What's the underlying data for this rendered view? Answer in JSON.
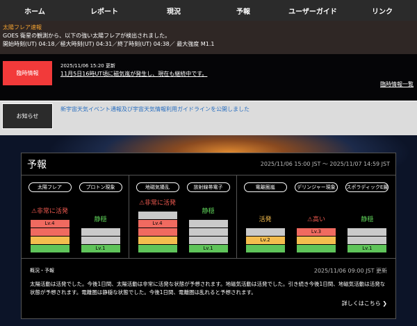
{
  "nav": [
    "ホーム",
    "レポート",
    "現況",
    "予報",
    "ユーザーガイド",
    "リンク"
  ],
  "alert": {
    "title": "太陽フレア速報",
    "line1": "GOES 衛星の観測から、以下の強い太陽フレアが検出されました。",
    "line2": "開始時刻(UT) 04:18／極大時刻(UT) 04:31／終了時刻(UT) 04:38／ 最大強度 M1.1"
  },
  "rapid": {
    "badge": "臨時情報",
    "date": "2025/11/06 15:20 更新",
    "message": "11月5日16時UT頃に磁気嵐が発生し、現在も継続中です。",
    "list_link": "臨時情報一覧"
  },
  "notice": {
    "badge": "お知らせ",
    "link": "新宇宙天気イベント通報及び宇宙天気情報利用ガイドラインを公開しました"
  },
  "forecast": {
    "title": "予報",
    "range": "2025/11/06 15:00 JST ～ 2025/11/07 14:59 JST",
    "groups": [
      [
        {
          "name": "太陽フレア",
          "status": "非常に活発",
          "warn": true,
          "color": "#f05a50",
          "cells": [
            [
              "green",
              ""
            ],
            [
              "yellow",
              ""
            ],
            [
              "red",
              ""
            ],
            [
              "red",
              "Lv.4"
            ]
          ]
        },
        {
          "name": "プロトン現象",
          "status": "静穏",
          "warn": false,
          "color": "#5fd45a",
          "cells": [
            [
              "green",
              "Lv.1"
            ],
            [
              "gray",
              ""
            ],
            [
              "gray",
              ""
            ]
          ]
        }
      ],
      [
        {
          "name": "地磁気擾乱",
          "status": "非常に活発",
          "warn": true,
          "color": "#f05a50",
          "cells": [
            [
              "green",
              ""
            ],
            [
              "yellow",
              ""
            ],
            [
              "red",
              ""
            ],
            [
              "red",
              "Lv.4"
            ],
            [
              "gray",
              ""
            ]
          ]
        },
        {
          "name": "放射線帯電子",
          "status": "静穏",
          "warn": false,
          "color": "#5fd45a",
          "cells": [
            [
              "green",
              "Lv.1"
            ],
            [
              "gray",
              ""
            ],
            [
              "gray",
              ""
            ],
            [
              "gray",
              ""
            ]
          ]
        }
      ],
      [
        {
          "name": "電離圏嵐",
          "status": "活発",
          "warn": false,
          "color": "#f4bd4e",
          "cells": [
            [
              "green",
              ""
            ],
            [
              "yellow",
              "Lv.2"
            ],
            [
              "gray",
              ""
            ]
          ]
        },
        {
          "name": "デリンジャー現象",
          "status": "高い",
          "warn": true,
          "color": "#f05a50",
          "cells": [
            [
              "green",
              ""
            ],
            [
              "yellow",
              ""
            ],
            [
              "red",
              "Lv.3"
            ]
          ]
        },
        {
          "name": "スポラディックE層",
          "status": "静穏",
          "warn": false,
          "color": "#5fd45a",
          "cells": [
            [
              "green",
              "Lv.1"
            ],
            [
              "gray",
              ""
            ],
            [
              "gray",
              ""
            ]
          ]
        }
      ]
    ]
  },
  "summary": {
    "title": "概況・予報",
    "updated": "2025/11/06 09:00 JST 更新",
    "body": "太陽活動は活発でした。今後1日間、太陽活動は非常に活発な状態が予想されます。地磁気活動は活発でした。引き続き今後1日間、地磁気活動は活発な状態が予想されます。電離圏は静穏な状態でした。今後1日間、電離圏は乱れると予想されます。",
    "more": "詳しくはこちら ❯"
  }
}
